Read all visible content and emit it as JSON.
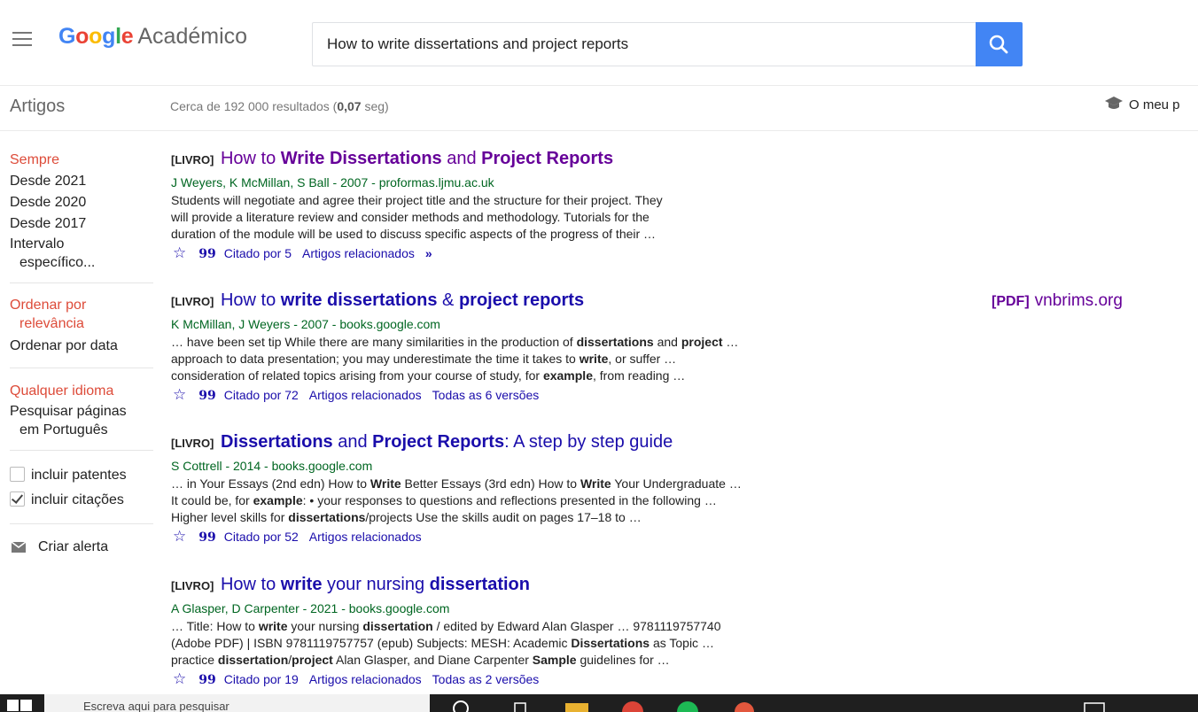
{
  "header": {
    "logo_word": "Google",
    "logo_sub": "Académico",
    "search_value": "How to write dissertations and project reports",
    "menu_icon": "hamburger-icon",
    "search_icon": "search-icon"
  },
  "subheader": {
    "section_title": "Artigos",
    "stats_prefix": "Cerca de 192 000 resultados (",
    "stats_time": "0,07",
    "stats_suffix": " seg)",
    "my_profile_label": "O meu p",
    "profile_icon": "graduation-cap-icon"
  },
  "sidebar": {
    "time": [
      "Sempre",
      "Desde 2021",
      "Desde 2020",
      "Desde 2017"
    ],
    "time_custom_1": "Intervalo",
    "time_custom_2": "específico...",
    "sort_relevance_1": "Ordenar por",
    "sort_relevance_2": "relevância",
    "sort_date": "Ordenar por data",
    "lang_any": "Qualquer idioma",
    "lang_pt_1": "Pesquisar páginas",
    "lang_pt_2": "em Português",
    "include_patents": "incluir patentes",
    "include_citations": "incluir citações",
    "create_alert": "Criar alerta",
    "alert_icon": "envelope-icon"
  },
  "results": [
    {
      "tag": "[LIVRO]",
      "title_parts": [
        "How to ",
        "Write Dissertations",
        " and ",
        "Project Reports"
      ],
      "authors": "J Weyers, K McMillan, S Ball - 2007 - proformas.ljmu.ac.uk",
      "snippet": [
        "Students will negotiate and agree their project title and the structure for their project. They",
        "will provide a literature review and consider methods and methodology. Tutorials for the",
        "duration of the module will be used to discuss specific aspects of the progress of their …"
      ],
      "cited": "Citado por 5",
      "related": "Artigos relacionados",
      "versions": ""
    },
    {
      "tag": "[LIVRO]",
      "title_parts": [
        "How to ",
        "write dissertations",
        " & ",
        "project reports"
      ],
      "authors": "K McMillan, J Weyers - 2007 - books.google.com",
      "cited": "Citado por 72",
      "related": "Artigos relacionados",
      "versions": "Todas as 6 versões"
    },
    {
      "tag": "[LIVRO]",
      "title_parts": [
        "",
        "Dissertations",
        " and ",
        "Project Reports",
        ": A step by step guide"
      ],
      "authors": "S Cottrell - 2014 - books.google.com",
      "cited": "Citado por 52",
      "related": "Artigos relacionados",
      "versions": ""
    },
    {
      "tag": "[LIVRO]",
      "title_parts": [
        "How to ",
        "write",
        " your nursing ",
        "dissertation"
      ],
      "authors": "A Glasper, D Carpenter - 2021 - books.google.com",
      "cited": "Citado por 19",
      "related": "Artigos relacionados",
      "versions": "Todas as 2 versões"
    }
  ],
  "snippets_rich": {
    "r2": [
      [
        "… have been set tip While there are many similarities in the production of ",
        "dissertations",
        " and ",
        "project",
        " …"
      ],
      [
        "approach to data presentation; you may underestimate the time it takes to ",
        "write",
        ", or suffer …"
      ],
      [
        "consideration of related topics arising from your course of study, for ",
        "example",
        ", from reading …"
      ]
    ],
    "r3": [
      [
        "… in Your Essays (2nd edn) How to ",
        "Write",
        " Better Essays (3rd edn) How to ",
        "Write",
        " Your Undergraduate …"
      ],
      [
        "It could be, for ",
        "example",
        ": • your responses to questions and reflections presented in the following …"
      ],
      [
        "Higher level skills for ",
        "dissertations",
        "/projects Use the skills audit on pages 17–18 to …"
      ]
    ],
    "r4": [
      [
        "… Title: How to ",
        "write",
        " your nursing ",
        "dissertation",
        " / edited by Edward Alan Glasper … 9781119757740"
      ],
      [
        "(Adobe PDF) | ISBN 9781119757757 (epub) Subjects: MESH: Academic ",
        "Dissertations",
        " as Topic …"
      ],
      [
        "practice ",
        "dissertation",
        "/",
        "project",
        " Alan Glasper, and Diane Carpenter ",
        "Sample",
        " guidelines for …"
      ]
    ]
  },
  "pdf": {
    "tag": "[PDF]",
    "domain": "vnbrims.org"
  },
  "taskbar": {
    "search_placeholder": "Escreva aqui para pesquisar"
  },
  "colors": {
    "link": "#1a0dab",
    "visited": "#660099",
    "authors": "#006621",
    "selected": "#dd4b39",
    "search_button": "#4285f4"
  }
}
